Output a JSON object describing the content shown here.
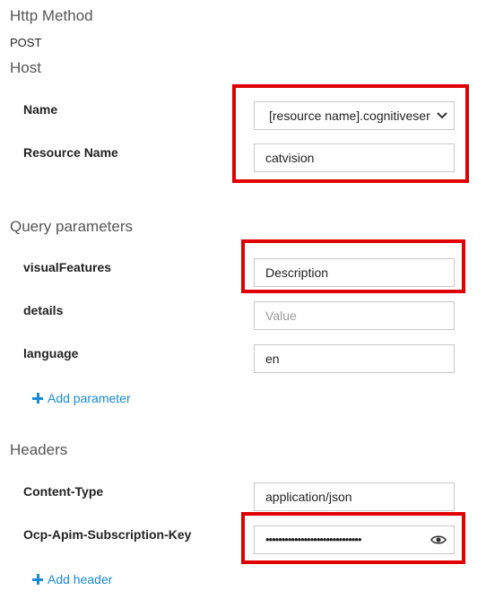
{
  "http_method": {
    "title": "Http Method",
    "value": "POST"
  },
  "host": {
    "title": "Host",
    "name_label": "Name",
    "name_selected": "[resource name].cognitiveser",
    "resource_label": "Resource Name",
    "resource_value": "catvision"
  },
  "query": {
    "title": "Query parameters",
    "params": [
      {
        "label": "visualFeatures",
        "value": "Description",
        "placeholder": ""
      },
      {
        "label": "details",
        "value": "",
        "placeholder": "Value"
      },
      {
        "label": "language",
        "value": "en",
        "placeholder": ""
      }
    ],
    "add_label": "Add parameter"
  },
  "headers": {
    "title": "Headers",
    "items": [
      {
        "label": "Content-Type",
        "value": "application/json"
      },
      {
        "label": "Ocp-Apim-Subscription-Key",
        "value": "••••••••••••••••••••••••••••••"
      }
    ],
    "add_label": "Add header"
  },
  "icons": {
    "plus": "plus-icon",
    "eye": "eye-icon",
    "chevron": "chevron-down-icon"
  },
  "colors": {
    "highlight": "#e00000",
    "link": "#1a8ad4",
    "field_border": "#c8c8c8"
  }
}
